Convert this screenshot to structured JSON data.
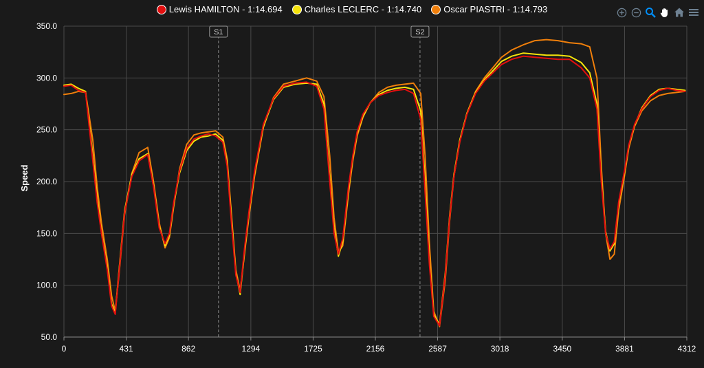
{
  "toolbar": {
    "icons": [
      "zoom-in-icon",
      "zoom-out-icon",
      "selection-zoom-icon",
      "pan-hand-icon",
      "home-reset-icon",
      "menu-icon"
    ]
  },
  "chart_data": {
    "type": "line",
    "ylabel": "Speed",
    "xlabel": "",
    "xlim": [
      0,
      4312
    ],
    "ylim": [
      50,
      350
    ],
    "x_ticks": [
      "0",
      "431",
      "862",
      "1294",
      "1725",
      "2156",
      "2587",
      "3018",
      "3450",
      "3881",
      "4312"
    ],
    "x_tick_values": [
      0,
      431,
      862,
      1294,
      1725,
      2156,
      2587,
      3018,
      3450,
      3881,
      4312
    ],
    "y_ticks": [
      "50.0",
      "100.0",
      "150.0",
      "200.0",
      "250.0",
      "300.0",
      "350.0"
    ],
    "y_tick_values": [
      50,
      100,
      150,
      200,
      250,
      300,
      350
    ],
    "grid": true,
    "legend_position": "top-center",
    "sector_markers": [
      {
        "label": "S1",
        "x": 1070
      },
      {
        "label": "S2",
        "x": 2465
      }
    ],
    "series": [
      {
        "name": "Lewis HAMILTON - 1:14.694",
        "color": "#e30f0f",
        "x": [
          0,
          50,
          100,
          150,
          200,
          230,
          260,
          300,
          330,
          355,
          380,
          420,
          470,
          520,
          580,
          620,
          660,
          700,
          730,
          760,
          800,
          850,
          900,
          950,
          1000,
          1050,
          1100,
          1130,
          1160,
          1190,
          1220,
          1250,
          1280,
          1320,
          1380,
          1450,
          1520,
          1600,
          1680,
          1750,
          1800,
          1840,
          1870,
          1900,
          1930,
          1970,
          2000,
          2030,
          2070,
          2120,
          2180,
          2240,
          2300,
          2360,
          2420,
          2470,
          2500,
          2530,
          2560,
          2600,
          2640,
          2670,
          2700,
          2740,
          2790,
          2850,
          2910,
          2970,
          3030,
          3100,
          3180,
          3260,
          3340,
          3420,
          3500,
          3580,
          3640,
          3690,
          3720,
          3750,
          3780,
          3810,
          3840,
          3880,
          3910,
          3950,
          4000,
          4060,
          4120,
          4180,
          4240,
          4300
        ],
        "y": [
          292,
          293,
          288,
          286,
          220,
          180,
          150,
          115,
          80,
          72,
          110,
          170,
          205,
          220,
          226,
          195,
          155,
          140,
          150,
          180,
          210,
          232,
          241,
          244,
          246,
          244,
          238,
          215,
          160,
          110,
          93,
          135,
          170,
          210,
          255,
          280,
          292,
          295,
          296,
          292,
          270,
          200,
          150,
          130,
          145,
          195,
          225,
          248,
          265,
          276,
          283,
          286,
          288,
          289,
          285,
          260,
          190,
          120,
          70,
          61,
          110,
          165,
          205,
          238,
          265,
          285,
          297,
          305,
          313,
          318,
          321,
          320,
          319,
          318,
          318,
          310,
          300,
          270,
          200,
          150,
          135,
          142,
          180,
          210,
          235,
          255,
          270,
          282,
          288,
          290,
          288,
          287
        ]
      },
      {
        "name": "Charles LECLERC - 1:14.740",
        "color": "#f5e30b",
        "x": [
          0,
          50,
          100,
          150,
          200,
          230,
          260,
          300,
          330,
          355,
          380,
          420,
          470,
          520,
          580,
          620,
          660,
          700,
          730,
          760,
          800,
          850,
          900,
          950,
          1000,
          1050,
          1100,
          1130,
          1160,
          1190,
          1220,
          1250,
          1280,
          1320,
          1380,
          1450,
          1520,
          1600,
          1680,
          1750,
          1800,
          1840,
          1870,
          1900,
          1930,
          1970,
          2000,
          2030,
          2070,
          2120,
          2180,
          2240,
          2300,
          2360,
          2420,
          2470,
          2500,
          2530,
          2560,
          2600,
          2640,
          2670,
          2700,
          2740,
          2790,
          2850,
          2910,
          2970,
          3030,
          3100,
          3180,
          3260,
          3340,
          3420,
          3500,
          3580,
          3640,
          3690,
          3720,
          3750,
          3780,
          3810,
          3840,
          3880,
          3910,
          3950,
          4000,
          4060,
          4120,
          4180,
          4240,
          4300
        ],
        "y": [
          293,
          294,
          290,
          287,
          225,
          185,
          152,
          118,
          82,
          73,
          112,
          172,
          207,
          222,
          227,
          197,
          157,
          138,
          148,
          178,
          208,
          230,
          239,
          243,
          244,
          246,
          240,
          218,
          165,
          112,
          91,
          132,
          168,
          208,
          253,
          279,
          291,
          294,
          295,
          294,
          275,
          205,
          155,
          128,
          142,
          192,
          223,
          246,
          263,
          276,
          284,
          288,
          290,
          291,
          289,
          268,
          200,
          125,
          72,
          62,
          112,
          167,
          207,
          240,
          266,
          286,
          298,
          307,
          316,
          321,
          324,
          323,
          322,
          322,
          321,
          315,
          305,
          275,
          205,
          152,
          133,
          140,
          178,
          208,
          234,
          254,
          271,
          283,
          289,
          290,
          289,
          288
        ]
      },
      {
        "name": "Oscar PIASTRI - 1:14.793",
        "color": "#f07f0b",
        "x": [
          0,
          50,
          100,
          150,
          200,
          230,
          260,
          300,
          330,
          355,
          380,
          420,
          470,
          520,
          580,
          620,
          660,
          700,
          730,
          760,
          800,
          850,
          900,
          950,
          1000,
          1050,
          1100,
          1130,
          1160,
          1190,
          1220,
          1250,
          1280,
          1320,
          1380,
          1450,
          1520,
          1600,
          1680,
          1750,
          1800,
          1840,
          1870,
          1900,
          1930,
          1970,
          2000,
          2030,
          2070,
          2120,
          2180,
          2240,
          2300,
          2360,
          2420,
          2470,
          2500,
          2530,
          2560,
          2600,
          2640,
          2670,
          2700,
          2740,
          2790,
          2850,
          2910,
          2970,
          3030,
          3100,
          3180,
          3260,
          3340,
          3420,
          3500,
          3580,
          3640,
          3690,
          3720,
          3750,
          3780,
          3810,
          3840,
          3880,
          3910,
          3950,
          4000,
          4060,
          4120,
          4180,
          4240,
          4300
        ],
        "y": [
          284,
          285,
          287,
          286,
          240,
          195,
          160,
          125,
          90,
          75,
          108,
          168,
          208,
          228,
          233,
          200,
          160,
          136,
          146,
          176,
          212,
          236,
          245,
          247,
          248,
          249,
          243,
          222,
          168,
          115,
          95,
          130,
          165,
          205,
          252,
          281,
          294,
          297,
          300,
          297,
          282,
          225,
          165,
          132,
          138,
          188,
          220,
          244,
          262,
          276,
          286,
          291,
          293,
          294,
          295,
          285,
          225,
          140,
          75,
          60,
          105,
          162,
          205,
          238,
          266,
          287,
          300,
          310,
          320,
          327,
          332,
          336,
          337,
          336,
          334,
          333,
          330,
          300,
          215,
          150,
          125,
          130,
          172,
          205,
          232,
          253,
          268,
          278,
          283,
          285,
          286,
          287
        ]
      }
    ]
  }
}
